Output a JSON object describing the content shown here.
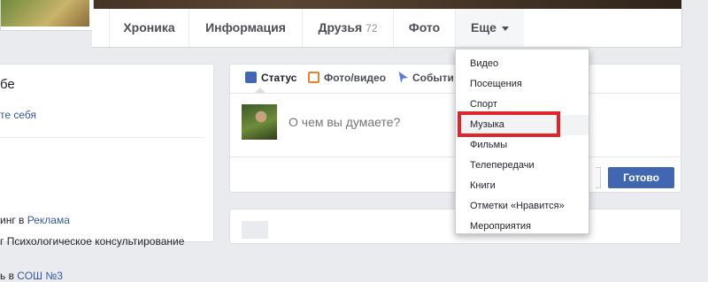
{
  "nav": {
    "items": [
      {
        "label": "Хроника"
      },
      {
        "label": "Информация"
      },
      {
        "label": "Друзья",
        "count": "72"
      },
      {
        "label": "Фото"
      },
      {
        "label": "Еще"
      }
    ]
  },
  "left": {
    "title_fragment": "бе",
    "link_fragment": "те себя",
    "lines": [
      {
        "text": "инг в ",
        "link": "Реклама"
      },
      {
        "text": "г Психологическое консультирование",
        "link": ""
      },
      {
        "text": "ь в ",
        "link": "СОШ №3"
      }
    ]
  },
  "composer": {
    "tabs": [
      {
        "label": "Статус",
        "icon": "status-pencil-icon"
      },
      {
        "label": "Фото/видео",
        "icon": "photo-video-icon"
      },
      {
        "label": "Событи",
        "icon": "life-event-icon"
      }
    ],
    "placeholder": "О чем вы думаете?",
    "done_label": "Готово"
  },
  "dropdown": {
    "items": [
      "Видео",
      "Посещения",
      "Спорт",
      "Музыка",
      "Фильмы",
      "Телепередачи",
      "Книги",
      "Отметки «Нравится»",
      "Мероприятия"
    ],
    "highlighted": "Музыка"
  },
  "colors": {
    "brand": "#4267b2",
    "link": "#365899",
    "highlight_box": "#e0242b"
  }
}
